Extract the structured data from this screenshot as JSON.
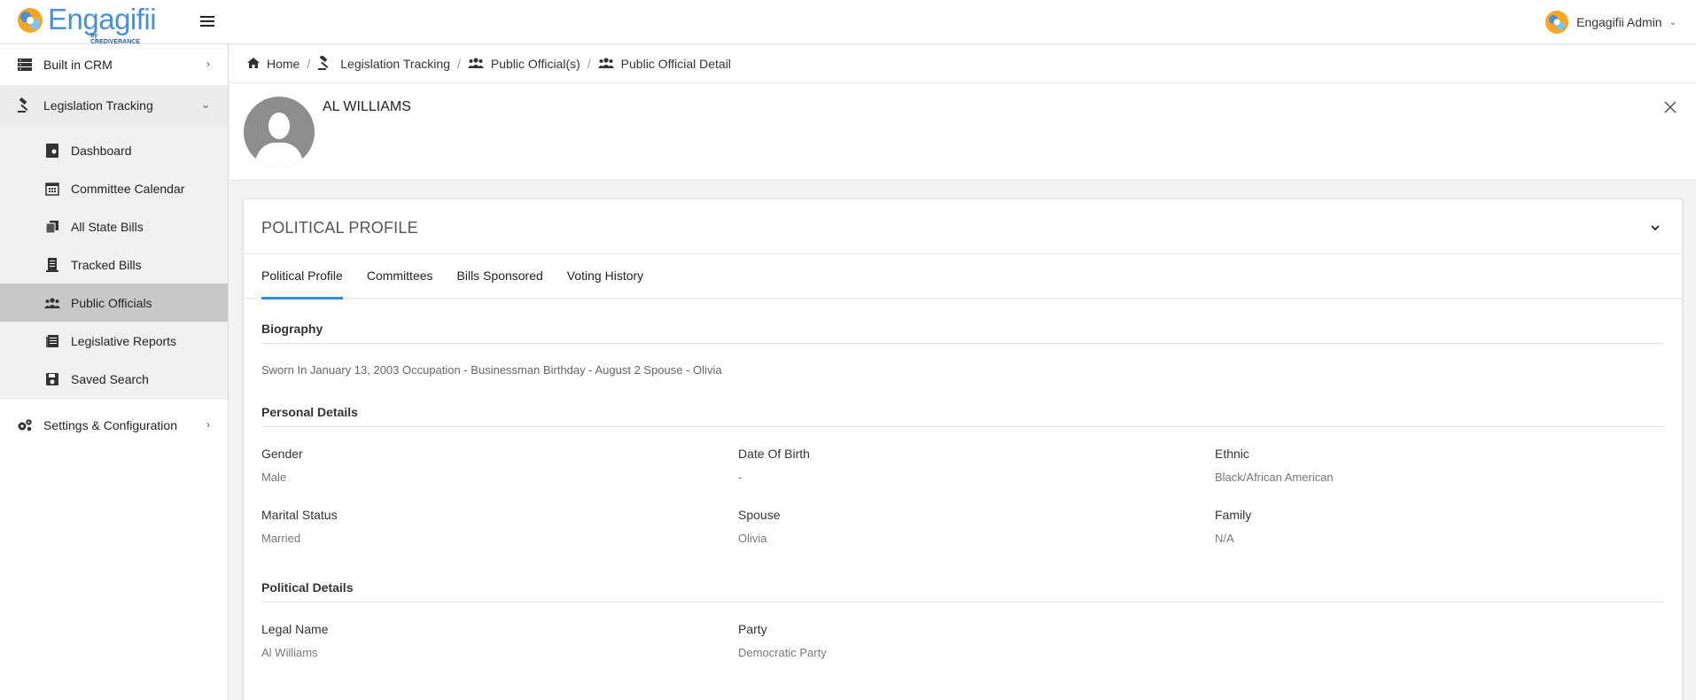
{
  "brand": {
    "name": "Engagifii",
    "tagline": "by CREDIVERANCE"
  },
  "user": {
    "name": "Engagifii Admin"
  },
  "sidebar": {
    "items": [
      {
        "label": "Built in CRM"
      },
      {
        "label": "Legislation Tracking"
      },
      {
        "label": "Settings & Configuration"
      }
    ],
    "sub_items": [
      {
        "label": "Dashboard"
      },
      {
        "label": "Committee Calendar"
      },
      {
        "label": "All State Bills"
      },
      {
        "label": "Tracked Bills"
      },
      {
        "label": "Public Officials"
      },
      {
        "label": "Legislative Reports"
      },
      {
        "label": "Saved Search"
      }
    ]
  },
  "breadcrumb": [
    {
      "label": "Home"
    },
    {
      "label": "Legislation Tracking"
    },
    {
      "label": "Public Official(s)"
    },
    {
      "label": "Public Official Detail"
    }
  ],
  "official": {
    "name": "AL WILLIAMS"
  },
  "card": {
    "title": "POLITICAL PROFILE",
    "tabs": [
      {
        "label": "Political Profile"
      },
      {
        "label": "Committees"
      },
      {
        "label": "Bills Sponsored"
      },
      {
        "label": "Voting History"
      }
    ]
  },
  "biography": {
    "title": "Biography",
    "text": "Sworn In January 13, 2003 Occupation - Businessman Birthday - August 2 Spouse - Olivia"
  },
  "personal": {
    "title": "Personal Details",
    "fields": [
      {
        "label": "Gender",
        "value": "Male"
      },
      {
        "label": "Date Of Birth",
        "value": "-"
      },
      {
        "label": "Ethnic",
        "value": "Black/African American"
      },
      {
        "label": "Marital Status",
        "value": "Married"
      },
      {
        "label": "Spouse",
        "value": "Olivia"
      },
      {
        "label": "Family",
        "value": "N/A"
      }
    ]
  },
  "political": {
    "title": "Political Details",
    "fields": [
      {
        "label": "Legal Name",
        "value": "Al Williams"
      },
      {
        "label": "Party",
        "value": "Democratic Party"
      }
    ]
  },
  "colors": {
    "accent": "#2c8fe0",
    "active_nav": "#c8c8c8",
    "avatar": "#8d8d8d"
  }
}
